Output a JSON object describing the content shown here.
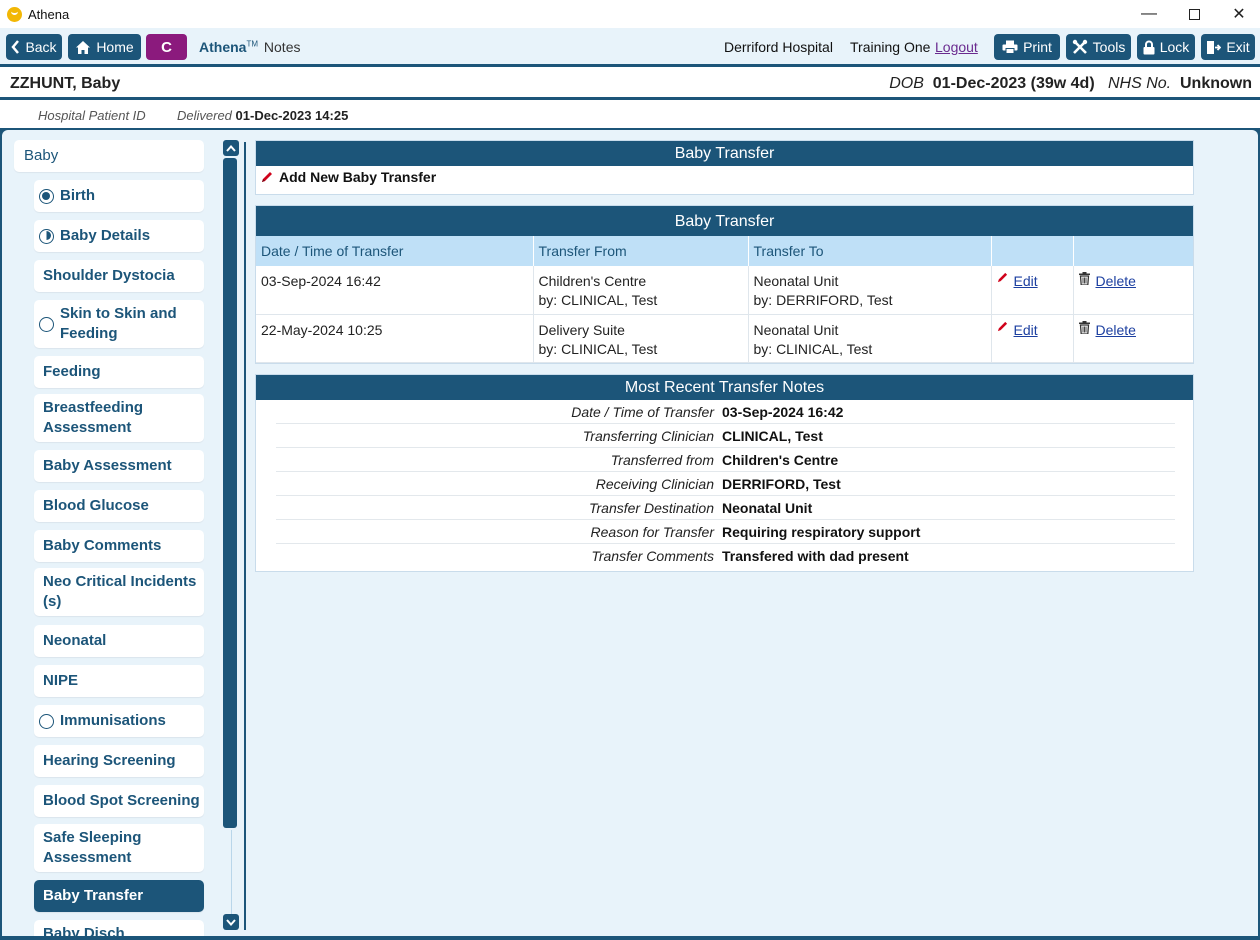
{
  "window": {
    "title": "Athena",
    "controls": {
      "minimize": "—",
      "close": "✕"
    }
  },
  "toolbar": {
    "back_label": "Back",
    "home_label": "Home",
    "c_label": "C",
    "brand_name": "Athena",
    "brand_tm": "TM",
    "brand_suffix": "Notes",
    "hospital": "Derriford Hospital",
    "user": "Training One",
    "logout_label": "Logout",
    "print_label": "Print",
    "tools_label": "Tools",
    "lock_label": "Lock",
    "exit_label": "Exit"
  },
  "patient": {
    "name": "ZZHUNT, Baby",
    "dob_label": "DOB",
    "dob_value": "01-Dec-2023 (39w 4d)",
    "nhs_label": "NHS No.",
    "nhs_value": "Unknown",
    "hospital_id_label": "Hospital Patient ID",
    "delivered_label": "Delivered",
    "delivered_value": "01-Dec-2023 14:25"
  },
  "sidebar": {
    "header": "Baby",
    "items": [
      {
        "label": "Birth",
        "icon": "full"
      },
      {
        "label": "Baby Details",
        "icon": "half"
      },
      {
        "label": "Shoulder Dystocia",
        "icon": ""
      },
      {
        "label": "Skin to Skin and Feeding",
        "icon": "empty"
      },
      {
        "label": "Feeding",
        "icon": ""
      },
      {
        "label": "Breastfeeding Assessment",
        "icon": ""
      },
      {
        "label": "Baby Assessment",
        "icon": ""
      },
      {
        "label": "Blood Glucose",
        "icon": ""
      },
      {
        "label": "Baby Comments",
        "icon": ""
      },
      {
        "label": "Neo Critical Incidents (s)",
        "icon": ""
      },
      {
        "label": "Neonatal",
        "icon": ""
      },
      {
        "label": "NIPE",
        "icon": ""
      },
      {
        "label": "Immunisations",
        "icon": "empty"
      },
      {
        "label": "Hearing Screening",
        "icon": ""
      },
      {
        "label": "Blood Spot Screening",
        "icon": ""
      },
      {
        "label": "Safe Sleeping Assessment",
        "icon": ""
      },
      {
        "label": "Baby Transfer",
        "icon": ""
      },
      {
        "label": "Baby Disch",
        "icon": ""
      }
    ]
  },
  "add_panel": {
    "title": "Baby Transfer",
    "add_label": "Add New Baby Transfer"
  },
  "transfer_table": {
    "title": "Baby Transfer",
    "columns": [
      "Date / Time of Transfer",
      "Transfer From",
      "Transfer To",
      "",
      ""
    ],
    "rows": [
      {
        "datetime": "03-Sep-2024 16:42",
        "from": "Children's Centre",
        "from_by": "by: CLINICAL, Test",
        "to": "Neonatal Unit",
        "to_by": "by: DERRIFORD, Test",
        "edit": "Edit",
        "delete": "Delete"
      },
      {
        "datetime": "22-May-2024 10:25",
        "from": "Delivery Suite",
        "from_by": "by: CLINICAL, Test",
        "to": "Neonatal Unit",
        "to_by": "by: CLINICAL, Test",
        "edit": "Edit",
        "delete": "Delete"
      }
    ]
  },
  "recent_notes": {
    "title": "Most Recent Transfer Notes",
    "fields": [
      {
        "label": "Date / Time of Transfer",
        "value": "03-Sep-2024 16:42"
      },
      {
        "label": "Transferring Clinician",
        "value": "CLINICAL, Test"
      },
      {
        "label": "Transferred from",
        "value": "Children's Centre"
      },
      {
        "label": "Receiving Clinician",
        "value": "DERRIFORD, Test"
      },
      {
        "label": "Transfer Destination",
        "value": "Neonatal Unit"
      },
      {
        "label": "Reason for Transfer",
        "value": "Requiring respiratory support"
      },
      {
        "label": "Transfer Comments",
        "value": "Transfered with dad present"
      }
    ]
  },
  "colors": {
    "primary": "#1c5579",
    "accent_c": "#8b1a7d",
    "background": "#e8f3fa",
    "table_header": "#bfe0f7"
  }
}
